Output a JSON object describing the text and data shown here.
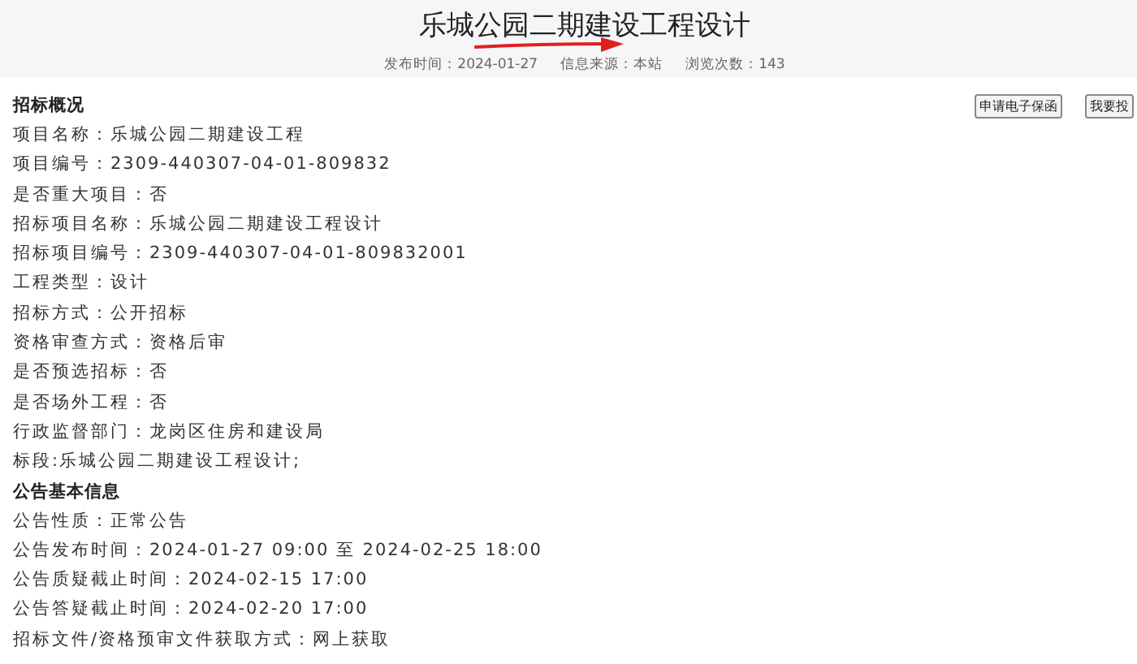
{
  "title": "乐城公园二期建设工程设计",
  "meta": [
    "发布时间：2024-01-27",
    "信息来源：本站",
    "浏览次数：143"
  ],
  "buttons": [
    "申请电子保函",
    "我要投"
  ],
  "sections": [
    {
      "heading": "招标概况",
      "lines": [
        "项目名称：乐城公园二期建设工程",
        "项目编号：2309-440307-04-01-809832",
        "是否重大项目：否",
        "招标项目名称：乐城公园二期建设工程设计",
        "招标项目编号：2309-440307-04-01-809832001",
        "工程类型：设计",
        "招标方式：公开招标",
        "资格审查方式：资格后审",
        "是否预选招标：否",
        "是否场外工程：否",
        "行政监督部门：龙岗区住房和建设局",
        "标段:乐城公园二期建设工程设计;"
      ]
    },
    {
      "heading": "公告基本信息",
      "lines": [
        "公告性质：正常公告",
        "公告发布时间：2024-01-27 09:00 至 2024-02-25 18:00",
        "公告质疑截止时间：2024-02-15 17:00",
        "公告答疑截止时间：2024-02-20 17:00",
        "招标文件/资格预审文件获取方式：网上获取"
      ]
    }
  ]
}
